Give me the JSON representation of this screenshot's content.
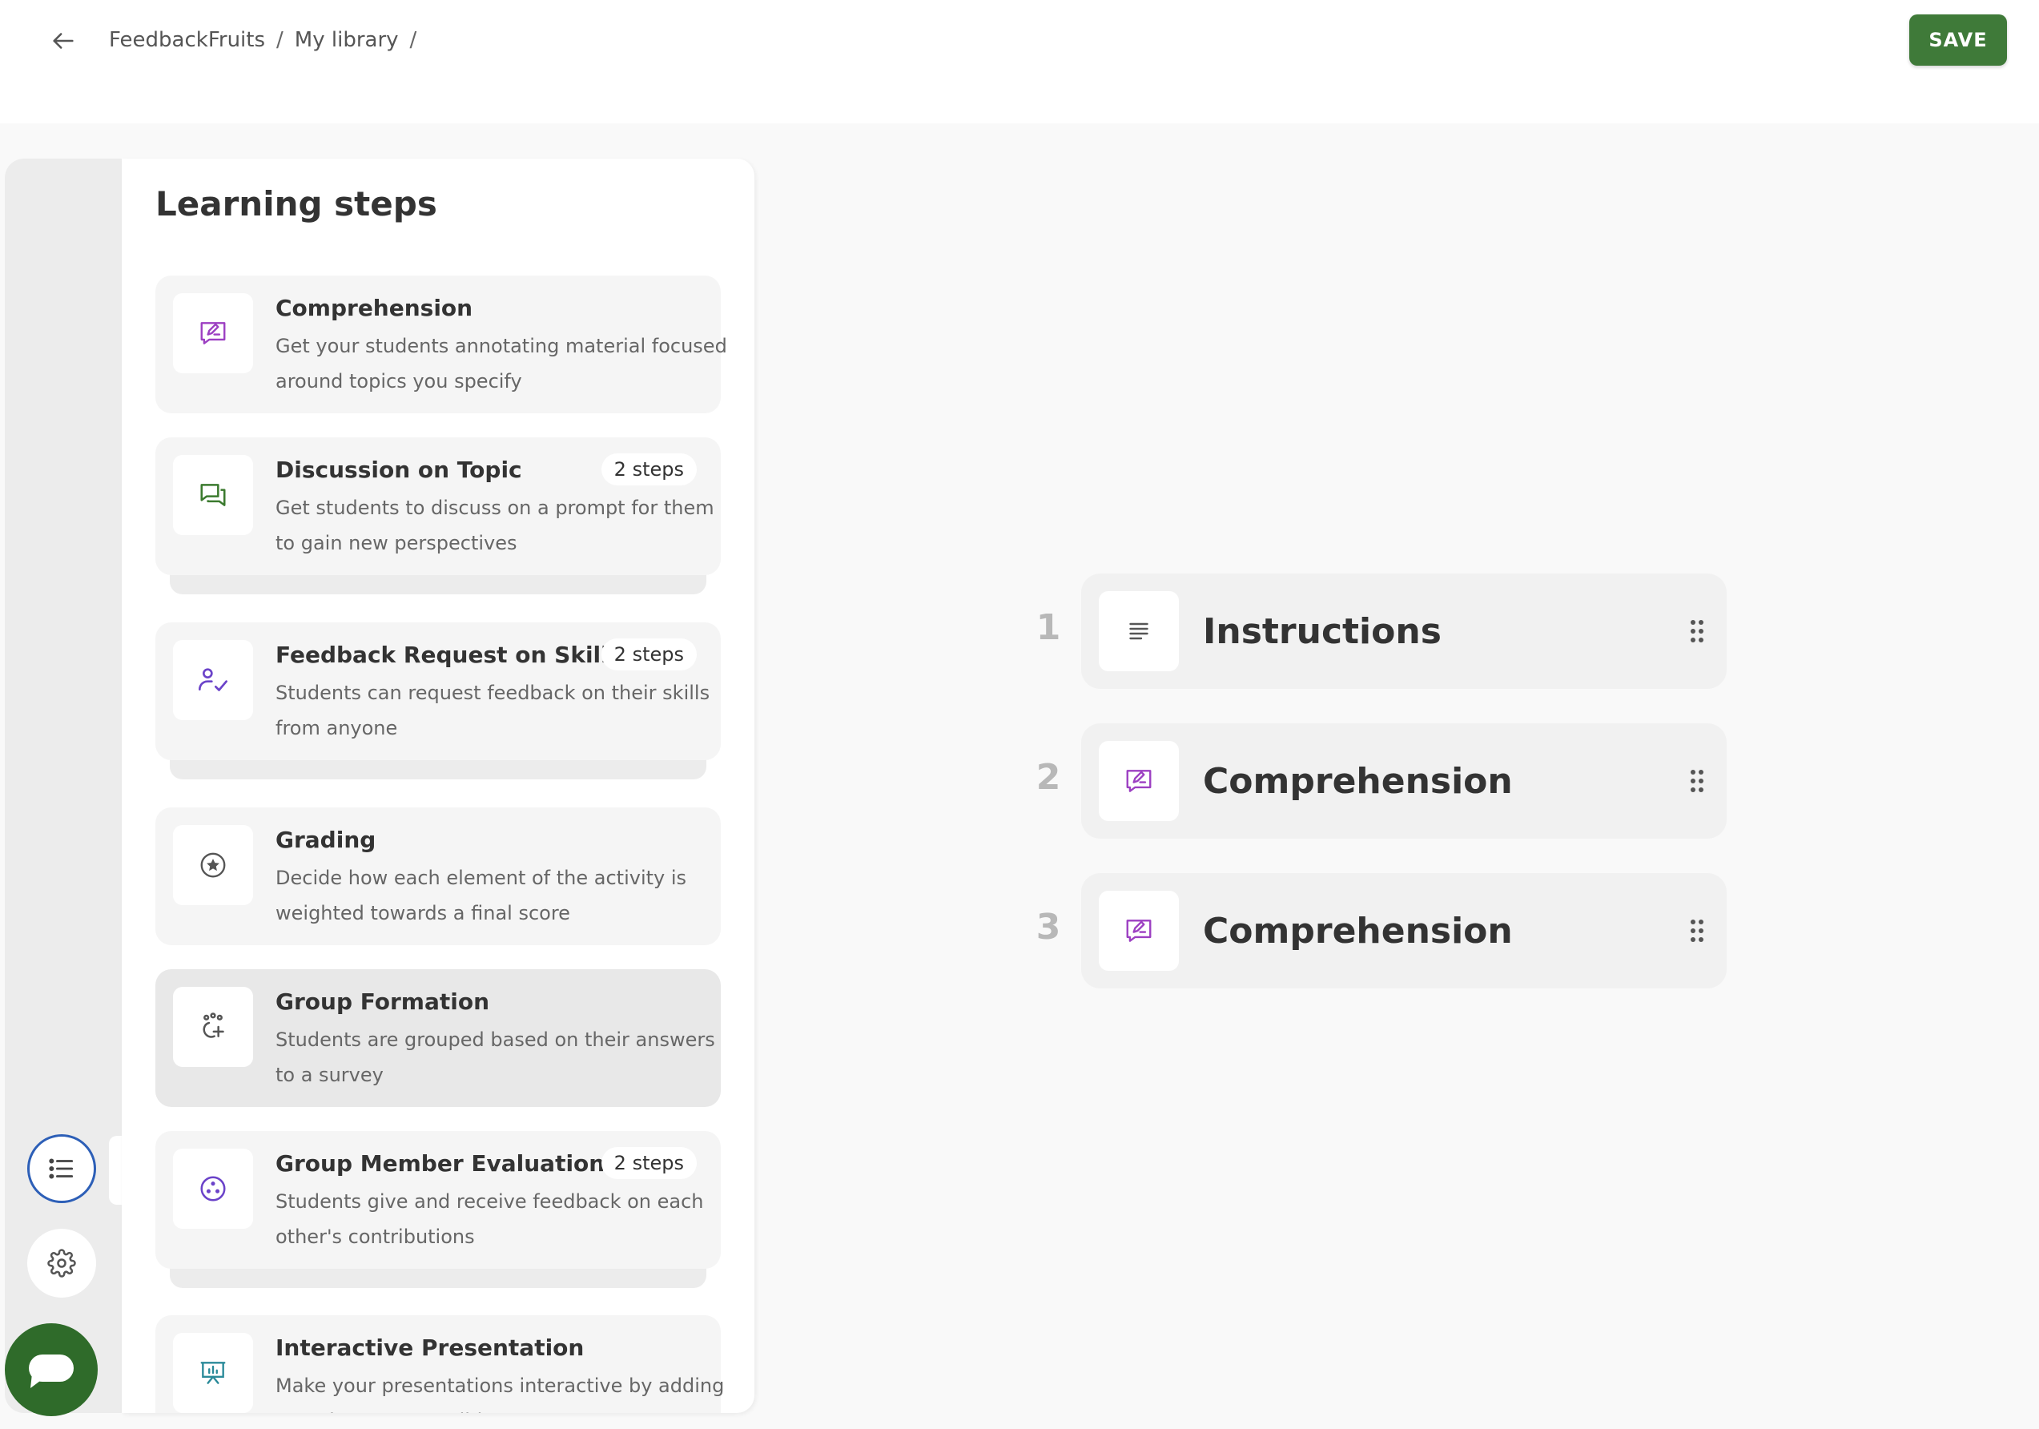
{
  "header": {
    "breadcrumb": [
      {
        "label": "FeedbackFruits"
      },
      {
        "label": "My library"
      }
    ],
    "separator": "/",
    "save_label": "SAVE"
  },
  "colors": {
    "save_green": "#3f7a39",
    "chat_green": "#2f6b2a",
    "active_ring_blue": "#2d5fb7",
    "comprehension_purple": "#9c3fc2",
    "discussion_green": "#3b7a2e",
    "skills_purple": "#6b43c9",
    "presentation_teal": "#2a8a99"
  },
  "panel": {
    "title": "Learning steps",
    "steps": [
      {
        "title": "Comprehension",
        "desc": [
          "Get your students annotating material focused",
          "around topics you specify"
        ],
        "badge": "",
        "icon": "annotate-icon"
      },
      {
        "title": "Discussion on Topic",
        "desc": [
          "Get students to discuss on a prompt for them",
          "to gain new perspectives"
        ],
        "badge": "2 steps",
        "icon": "chat-bubbles-icon"
      },
      {
        "title": "Feedback Request on Skills",
        "desc": [
          "Students can request feedback on their skills",
          "from anyone"
        ],
        "badge": "2 steps",
        "icon": "person-check-icon"
      },
      {
        "title": "Grading",
        "desc": [
          "Decide how each element of the activity is",
          "weighted towards a final score"
        ],
        "badge": "",
        "icon": "star-circle-icon"
      },
      {
        "title": "Group Formation",
        "desc": [
          "Students are grouped based on their answers",
          "to a survey"
        ],
        "badge": "",
        "icon": "group-add-icon"
      },
      {
        "title": "Group Member Evaluation",
        "desc": [
          "Students give and receive feedback on each",
          "other's contributions"
        ],
        "badge": "2 steps",
        "icon": "group-circle-icon"
      },
      {
        "title": "Interactive Presentation",
        "desc": [
          "Make your presentations interactive by adding",
          "questions to your slides"
        ],
        "badge": "",
        "icon": "presentation-icon"
      }
    ]
  },
  "sequence": [
    {
      "number": "1",
      "title": "Instructions",
      "icon": "text-lines-icon"
    },
    {
      "number": "2",
      "title": "Comprehension",
      "icon": "annotate-icon"
    },
    {
      "number": "3",
      "title": "Comprehension",
      "icon": "annotate-icon"
    }
  ]
}
